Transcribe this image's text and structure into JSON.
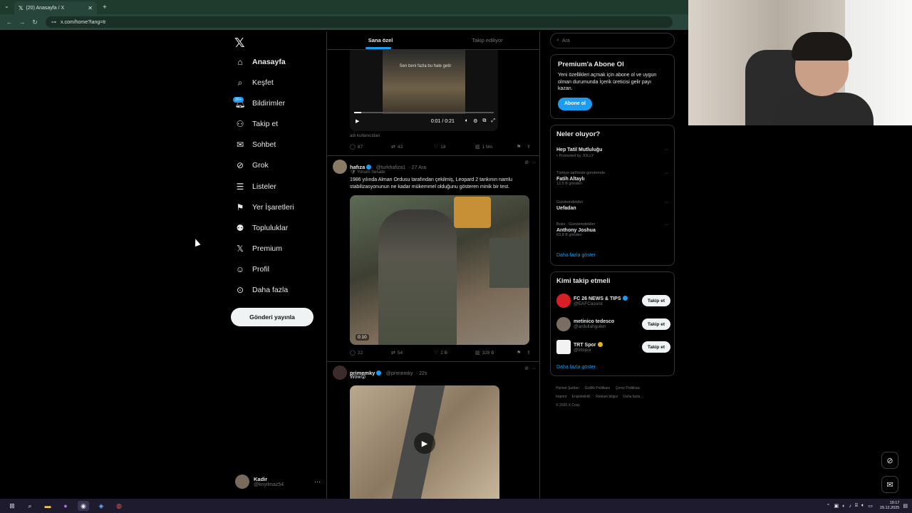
{
  "browser": {
    "tab_title": "(20) Anasayfa / X",
    "tab_icon": "x-logo-icon",
    "url": "x.com/home?lang=tr"
  },
  "nav": {
    "logo": "𝕏",
    "items": [
      {
        "label": "Anasayfa",
        "icon": "home-icon",
        "active": true
      },
      {
        "label": "Keşfet",
        "icon": "search-icon"
      },
      {
        "label": "Bildirimler",
        "icon": "bell-icon",
        "badge": "20+"
      },
      {
        "label": "Takip et",
        "icon": "person-add-icon"
      },
      {
        "label": "Sohbet",
        "icon": "mail-icon"
      },
      {
        "label": "Grok",
        "icon": "grok-icon"
      },
      {
        "label": "Listeler",
        "icon": "list-icon"
      },
      {
        "label": "Yer İşaretleri",
        "icon": "bookmark-icon"
      },
      {
        "label": "Topluluklar",
        "icon": "people-icon"
      },
      {
        "label": "Premium",
        "icon": "x-logo-icon"
      },
      {
        "label": "Profil",
        "icon": "person-icon"
      },
      {
        "label": "Daha fazla",
        "icon": "more-circle-icon"
      }
    ],
    "post_button": "Gönderi yayınla",
    "user": {
      "name": "Kadir",
      "handle": "@knyilmaz54"
    }
  },
  "feed": {
    "tabs": [
      "Sana özel",
      "Takip ediliyor"
    ],
    "tweet1": {
      "video_caption": "Sen beni fazla bu hale getir",
      "time": "0:01 / 0:21",
      "source_note": "adı kullanıcıdan",
      "stats": {
        "replies": "87",
        "reposts": "43",
        "likes": "18",
        "views": "1 Mn"
      }
    },
    "tweet2": {
      "name": "hafıza",
      "handle": "@turkhafiza1",
      "date": "· 27 Ara",
      "context": "Yorum hesabı",
      "text": "1986 yılında Alman Ordusu tarafından çekilmiş, Leopard 2 tankının namlu stabilizasyonunun ne kadar mükemmel olduğunu gösteren minik bir test.",
      "duration": "0:10",
      "stats": {
        "replies": "22",
        "reposts": "54",
        "likes": "2 B",
        "views": "328 B"
      }
    },
    "tweet3": {
      "name": "primemky",
      "handle": "@primemky",
      "date": "· 22s",
      "text": "Wow😮"
    }
  },
  "right": {
    "search_placeholder": "Ara",
    "premium": {
      "title": "Premium'a Abone Ol",
      "body": "Yeni özellikleri açmak için abone ol ve uygun olman durumunda İçerik üreticisi gelir payı kazan.",
      "button": "Abone ol"
    },
    "trends": {
      "title": "Neler oluyor?",
      "items": [
        {
          "context": "Promoted by JOLLY",
          "name": "Hep Tatil Mutluluğu",
          "posts": ""
        },
        {
          "context": "Türkiye tarihinde gündemde",
          "name": "Fatih Altaylı",
          "posts": "12,5 B gönderi"
        },
        {
          "context": "Gündemdekiler",
          "name": "Uefadan",
          "posts": ""
        },
        {
          "context": "Boks · Gündemdekiler",
          "name": "Anthony Joshua",
          "posts": "63,8 B gönderi"
        }
      ],
      "show_more": "Daha fazla göster"
    },
    "who": {
      "title": "Kimi takip etmeli",
      "items": [
        {
          "name": "FC 26 NEWS & TIPS",
          "handle": "@EAFCassist",
          "verified": true,
          "color": "#d81f26"
        },
        {
          "name": "metinico tedesco",
          "handle": "@ardullahgulen",
          "verified": false,
          "color": "#7a6e62"
        },
        {
          "name": "TRT Spor",
          "handle": "@trtspor",
          "verified": true,
          "color": "#f2f2f2"
        }
      ],
      "follow_label": "Takip et",
      "show_more": "Daha fazla göster"
    },
    "footer": [
      "Hizmet Şartları",
      "Gizlilik Politikası",
      "Çerez Politikası",
      "Imprint",
      "Erişilebilirlik",
      "Reklam bilgisi",
      "Daha fazla ...",
      "© 2025 X Corp."
    ]
  },
  "taskbar": {
    "time": "19:17",
    "date": "29.12.2025"
  },
  "colors": {
    "accent": "#1d9bf0",
    "bg": "#000000",
    "border": "#2f3336",
    "muted": "#71767b"
  }
}
